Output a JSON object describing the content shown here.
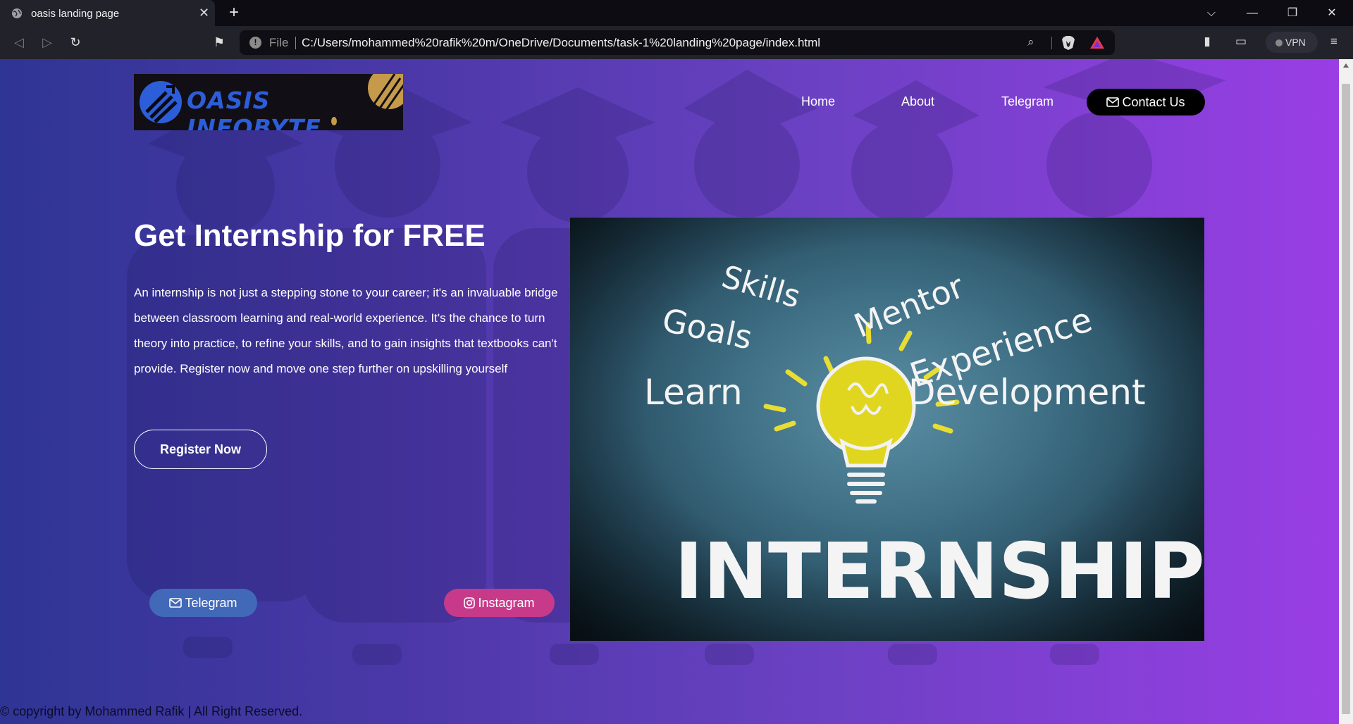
{
  "browser": {
    "tab_title": "oasis landing page",
    "url_scheme": "File",
    "url": "C:/Users/mohammed%20rafik%20m/OneDrive/Documents/task-1%20landing%20page/index.html",
    "vpn_label": "VPN"
  },
  "page": {
    "logo_text": "OASIS INFOBYTE",
    "nav": {
      "home": "Home",
      "about": "About",
      "telegram": "Telegram",
      "contact": "Contact Us"
    },
    "hero": {
      "title": "Get Internship for FREE",
      "description": "An internship is not just a stepping stone to your career; it's an invaluable bridge between classroom learning and real-world experience. It's the chance to turn theory into practice, to refine your skills, and to gain insights that textbooks can't provide. Register now and move one step further on upskilling yourself",
      "register_label": "Register Now"
    },
    "image_words": {
      "skills": "Skills",
      "mentor": "Mentor",
      "goals": "Goals",
      "experience": "Experience",
      "learn": "Learn",
      "development": "Development",
      "internship": "INTERNSHIP"
    },
    "social": {
      "telegram": "Telegram",
      "instagram": "Instagram"
    },
    "footer": "© copyright by Mohammed Rafik | All Right Reserved."
  },
  "colors": {
    "gradient_start": "#2f3594",
    "gradient_end": "#9a3de4",
    "telegram": "#4268b8",
    "instagram": "#c73a8a",
    "logo_text": "#2c5ed9"
  }
}
